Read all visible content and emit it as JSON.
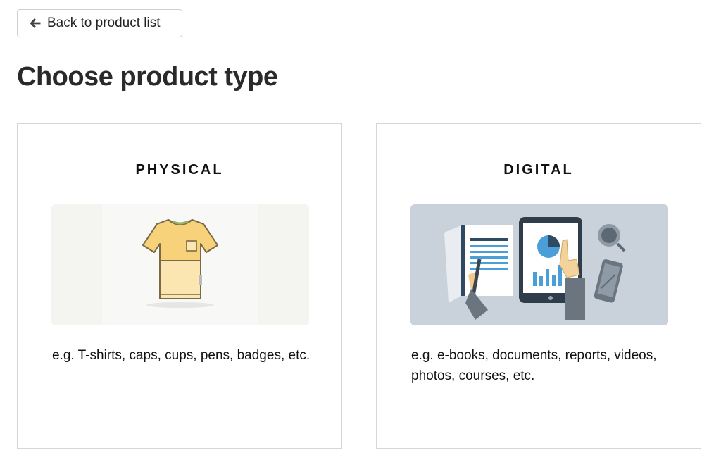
{
  "back_button": {
    "label": "Back to product list",
    "icon": "arrow-left-icon"
  },
  "page_title": "Choose product type",
  "cards": [
    {
      "title": "PHYSICAL",
      "description": "e.g. T-shirts, caps, cups, pens, badges, etc.",
      "illustration": "t-shirt-illustration",
      "accent": "#f7d27a"
    },
    {
      "title": "DIGITAL",
      "description": "e.g. e-books, documents, reports, videos, photos, courses, etc.",
      "illustration": "digital-devices-illustration",
      "accent": "#4a9fd8"
    }
  ]
}
